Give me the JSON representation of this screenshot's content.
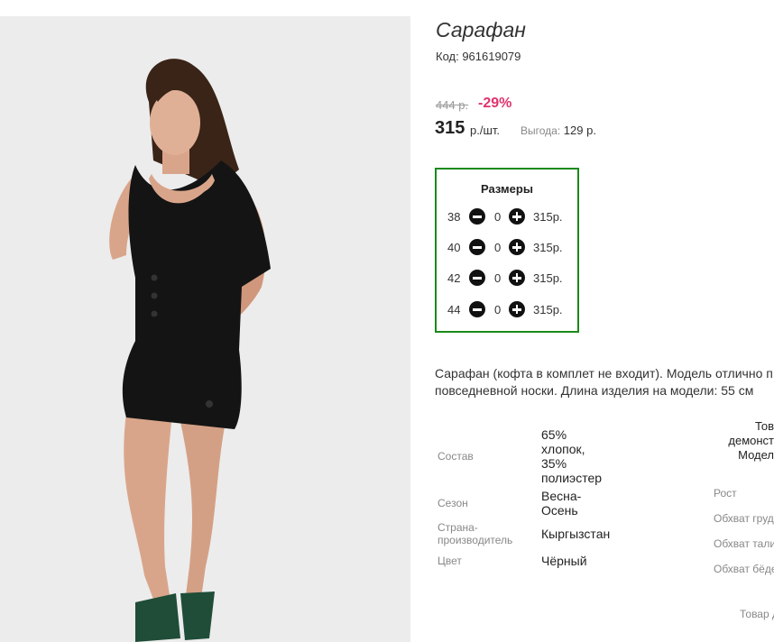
{
  "product": {
    "title": "Сарафан",
    "code_label": "Код: 961619079",
    "old_price": "444 р.",
    "discount": "-29%",
    "price": "315",
    "price_unit": "р./шт.",
    "profit_label": "Выгода:",
    "profit_value": "129 р."
  },
  "sizes": {
    "title": "Размеры",
    "rows": [
      {
        "size": "38",
        "qty": "0",
        "price": "315р."
      },
      {
        "size": "40",
        "qty": "0",
        "price": "315р."
      },
      {
        "size": "42",
        "qty": "0",
        "price": "315р."
      },
      {
        "size": "44",
        "qty": "0",
        "price": "315р."
      }
    ]
  },
  "description": {
    "line1": "Сарафан (кофта в комплет не входит). Модель отлично п",
    "line2": "повседневной носки. Длина изделия на модели: 55 см"
  },
  "attributes": [
    {
      "label": "Состав",
      "value": "65%\nхлопок,\n35%\nполиэстер"
    },
    {
      "label": "Сезон",
      "value": "Весна-\nОсень"
    },
    {
      "label": "Страна-\nпроизводитель",
      "value": "Кыргызстан"
    },
    {
      "label": "Цвет",
      "value": "Чёрный"
    }
  ],
  "model": {
    "head": "Тов\nдемонст\nМодел",
    "labels": [
      "Рост",
      "Обхват груд",
      "Обхват тали",
      "Обхват бёдє",
      "Товар д"
    ]
  },
  "colors": {
    "discount": "#e0336b",
    "sizes_border": "#1a8a1a",
    "dress": "#141414",
    "shoes": "#1f4d38"
  },
  "icons": {
    "minus": "minus-circle-icon",
    "plus": "plus-circle-icon"
  }
}
